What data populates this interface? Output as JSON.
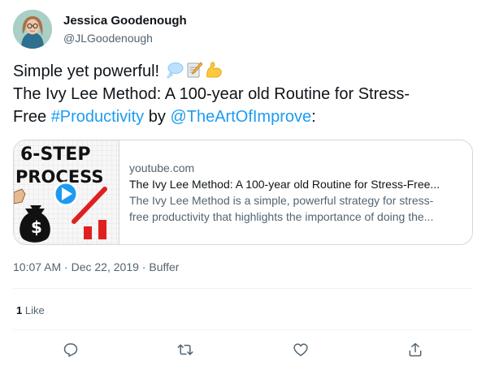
{
  "author": {
    "display_name": "Jessica Goodenough",
    "handle": "@JLGoodenough",
    "avatar_icon": "person-avatar"
  },
  "tweet": {
    "line1": "Simple yet powerful!",
    "line1_emojis": [
      "thought-balloon-icon",
      "memo-icon",
      "flexed-biceps-icon"
    ],
    "line2": "The Ivy Lee Method: A 100-year old Routine for Stress-",
    "line3_prefix": "Free ",
    "hashtag": "#Productivity",
    "by": " by ",
    "mention": "@TheArtOfImprove",
    "suffix": ":"
  },
  "card": {
    "domain": "youtube.com",
    "title": "The Ivy Lee Method: A 100-year old Routine for Stress-Free...",
    "description_line1": "The Ivy Lee Method is a simple, powerful strategy for stress-",
    "description_line2": "free productivity that highlights the importance of doing the...",
    "thumbnail_text_line1": "6-STEP",
    "thumbnail_text_line2": "PROCESS",
    "thumbnail_bag_symbol": "$",
    "play_icon": "play-icon"
  },
  "meta": {
    "time": "10:07 AM",
    "separator1": " · ",
    "date": "Dec 22, 2019",
    "separator2": " · ",
    "source": "Buffer"
  },
  "stats": {
    "likes_count": "1",
    "likes_label": " Like"
  },
  "actions": [
    "reply-icon",
    "retweet-icon",
    "like-icon",
    "share-icon"
  ],
  "colors": {
    "link": "#1d9bf0",
    "text": "#0f1419",
    "secondary": "#536471",
    "border": "#cfd9de"
  }
}
